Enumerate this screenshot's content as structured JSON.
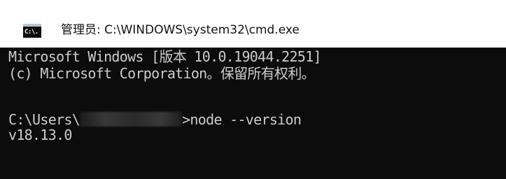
{
  "window": {
    "title": "管理员: C:\\WINDOWS\\system32\\cmd.exe",
    "icon": "cmd-icon",
    "icon_label": "C:\\."
  },
  "console": {
    "background": "#0c0c0c",
    "foreground": "#cccccc",
    "lines": [
      "Microsoft Windows [版本 10.0.19044.2251]",
      "(c) Microsoft Corporation。保留所有权利。",
      "",
      "v18.13.0"
    ],
    "prompt": {
      "prefix": "C:\\Users\\",
      "suffix": ">node --version"
    }
  }
}
